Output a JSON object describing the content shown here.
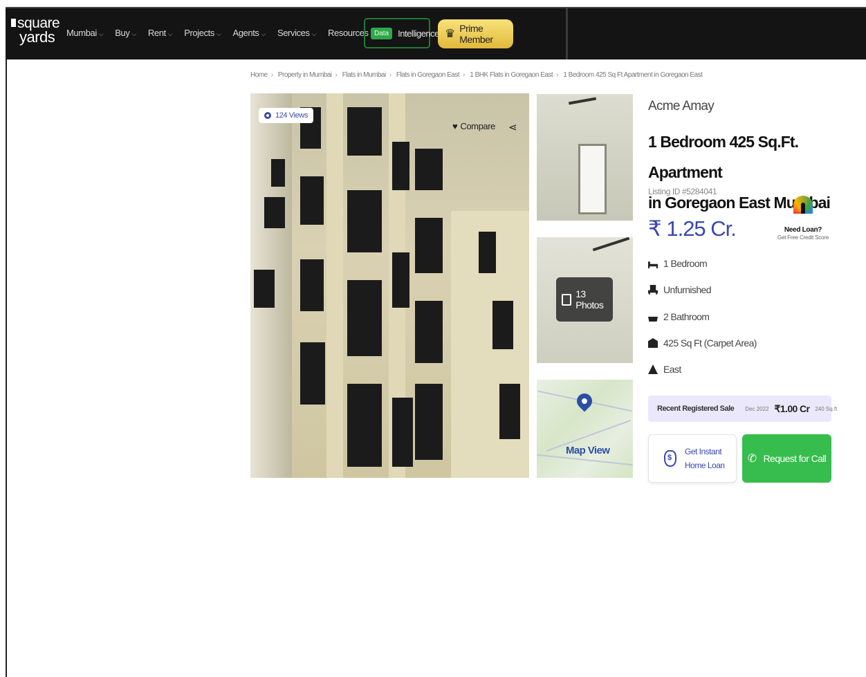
{
  "brand": {
    "line1": "square",
    "line2": "yards"
  },
  "nav": {
    "items": [
      {
        "label": "Mumbai"
      },
      {
        "label": "Buy"
      },
      {
        "label": "Rent"
      },
      {
        "label": "Projects"
      },
      {
        "label": "Agents"
      },
      {
        "label": "Services"
      },
      {
        "label": "Resources"
      }
    ],
    "data_badge": "Data",
    "data_label": "Intelligence",
    "prime_label": "Prime Member"
  },
  "breadcrumb": [
    "Home",
    "Property in Mumbai",
    "Flats in Mumbai",
    "Flats in Goregaon East",
    "1 BHK Flats in Goregaon East",
    "1 Bedroom 425 Sq Ft Apartment in Goregaon East"
  ],
  "gallery": {
    "views": "124 Views",
    "compare_label": "Compare",
    "photos_label": "13 Photos",
    "map_label": "Map View"
  },
  "listing": {
    "project": "Acme Amay",
    "title_line1": "1 Bedroom 425 Sq.Ft. Apartment",
    "title_line2": "in Goregaon East Mumbai",
    "listing_id": "Listing ID #5284041",
    "price": "₹ 1.25 Cr.",
    "loan_title": "Need Loan?",
    "loan_sub": "Get Free Credit Score",
    "features": [
      {
        "label": "1 Bedroom",
        "icon": "bed-icon"
      },
      {
        "label": "Unfurnished",
        "icon": "chair-icon"
      },
      {
        "label": "2 Bathroom",
        "icon": "bath-icon"
      },
      {
        "label": "425 Sq Ft (Carpet Area)",
        "icon": "area-icon"
      },
      {
        "label": "East",
        "icon": "facing-icon"
      }
    ],
    "recent_sale": {
      "label": "Recent Registered Sale",
      "date": "Dec 2022",
      "price": "₹1.00 Cr",
      "rate": "240 Sq.ft"
    },
    "home_loan_label": "Get Instant Home Loan",
    "call_label": "Request for Call"
  },
  "colors": {
    "accent": "#3a46b0",
    "cta": "#37bd4d",
    "prime": "#e1b93b"
  }
}
